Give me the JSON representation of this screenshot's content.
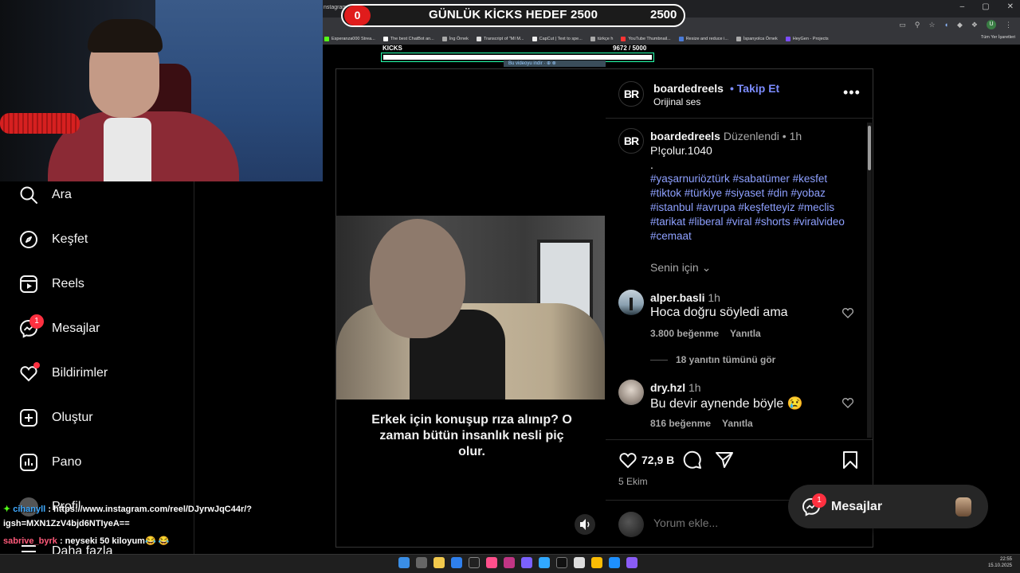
{
  "browser": {
    "tab_title": "nstagram",
    "bookmarks": [
      "Esperanza000 Strea...",
      "The best ChatBot an...",
      "İng Örnek",
      "Transcript of \"MI M...",
      "CapCut | Text to spe...",
      "türkçe h",
      "YouTube Thumbnail...",
      "Resize and reduce i...",
      "İspanyolca Örnek",
      "HeyGen - Projects"
    ],
    "bookmarks_right": "Tüm Yer İşaretleri",
    "profile_letter": "U"
  },
  "overlay": {
    "goal_counter": "0",
    "goal_title": "GÜNLÜK KİCKS HEDEF 2500",
    "goal_value": "2500",
    "kicks_label": "KICKS",
    "kicks_count": "9672  / 5000",
    "kicks_progress_pct": 100,
    "download_hint": "Bu videoyu indir · ⊕ ⊗"
  },
  "nav": {
    "items": [
      {
        "label": "Ara",
        "icon": "search-icon"
      },
      {
        "label": "Keşfet",
        "icon": "compass-icon"
      },
      {
        "label": "Reels",
        "icon": "reels-icon"
      },
      {
        "label": "Mesajlar",
        "icon": "messenger-icon",
        "badge": "1"
      },
      {
        "label": "Bildirimler",
        "icon": "heart-icon"
      },
      {
        "label": "Oluştur",
        "icon": "plus-square-icon"
      },
      {
        "label": "Pano",
        "icon": "dashboard-icon"
      },
      {
        "label": "Profil",
        "icon": "profile-icon"
      },
      {
        "label": "Daha fazla",
        "icon": "menu-icon"
      }
    ]
  },
  "chat": {
    "lines": [
      {
        "user": "cihanyll",
        "text": ": https://www.instagram.com/reel/DJyrwJqC44r/?"
      },
      {
        "user": "",
        "text": "igsh=MXN1ZzV4bjd6NTIyeA=="
      },
      {
        "user": "sabrive_byrk",
        "text": ": neyseki 50 kiloyum😂 😂"
      }
    ]
  },
  "video": {
    "caption": "Erkek için konuşup rıza alınıp? O zaman bütün insanlık nesli piç olur."
  },
  "post": {
    "logo_text": "BR",
    "username": "boardedreels",
    "follow_label": "• Takip Et",
    "audio": "Orijinal ses",
    "more": "•••",
    "caption_user": "boardedreels",
    "caption_edited": "Düzenlendi",
    "caption_time": "• 1h",
    "caption_text": "P!çolur.1040",
    "caption_dot": ".",
    "hashtags": "#yaşarnuriöztürk #sabatümer #kesfet #tiktok #türkiye #siyaset #din #yobaz #istanbul #avrupa #keşfetteyiz #meclis #tarikat #liberal #viral #shorts #viralvideo #cemaat",
    "for_you": "Senin için",
    "comments": [
      {
        "user": "alper.basli",
        "time": "1h",
        "text": "Hoca doğru söyledi ama",
        "likes": "3.800 beğenme",
        "reply": "Yanıtla"
      },
      {
        "user": "dry.hzl",
        "time": "1h",
        "text": "Bu devir aynende böyle 😢",
        "likes": "816 beğenme",
        "reply": "Yanıtla"
      }
    ],
    "view_replies": "18 yanıtın tümünü gör",
    "like_count": "72,9 B",
    "date": "5 Ekim",
    "comment_placeholder": "Yorum ekle..."
  },
  "messages_float": {
    "label": "Mesajlar",
    "badge": "1"
  },
  "taskbar": {
    "time": "22:55",
    "date": "15.10.2025"
  },
  "colors": {
    "link": "#8ea0ff",
    "follow": "#7c8cff",
    "badge": "#ff3040",
    "goal_red": "#e01c1c"
  }
}
